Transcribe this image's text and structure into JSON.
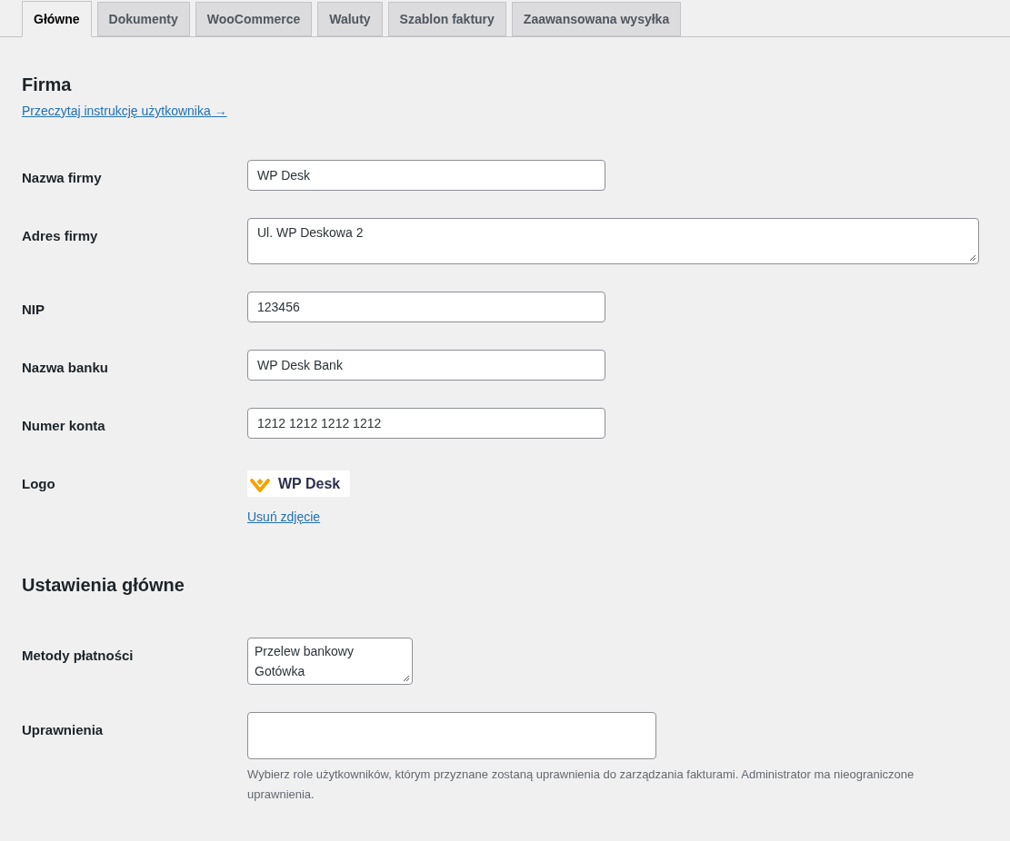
{
  "tabs": [
    {
      "label": "Główne",
      "selected": true
    },
    {
      "label": "Dokumenty",
      "selected": false
    },
    {
      "label": "WooCommerce",
      "selected": false
    },
    {
      "label": "Waluty",
      "selected": false
    },
    {
      "label": "Szablon faktury",
      "selected": false
    },
    {
      "label": "Zaawansowana wysyłka",
      "selected": false
    }
  ],
  "sections": [
    {
      "title": "Firma",
      "link": "Przeczytaj instrukcję użytkownika →",
      "fields": [
        {
          "kind": "text",
          "label": "Nazwa firmy",
          "value": "WP Desk"
        },
        {
          "kind": "textarea",
          "label": "Adres firmy",
          "value": "Ul. WP Deskowa 2"
        },
        {
          "kind": "text",
          "label": "NIP",
          "value": "123456"
        },
        {
          "kind": "text",
          "label": "Nazwa banku",
          "value": "WP Desk Bank"
        },
        {
          "kind": "text",
          "label": "Numer konta",
          "value": "1212 1212 1212 1212"
        },
        {
          "kind": "logo",
          "label": "Logo",
          "logo_text": "WP Desk",
          "action": "Usuń zdjęcie"
        }
      ]
    },
    {
      "title": "Ustawienia główne",
      "fields": [
        {
          "kind": "list",
          "label": "Metody płatności",
          "lines": [
            "Przelew bankowy",
            "Gotówka"
          ]
        },
        {
          "kind": "multiselect",
          "label": "Uprawnienia",
          "description": "Wybierz role użytkowników, którym przyznane zostaną uprawnienia do zarządzania fakturami. Administrator ma nieograniczone uprawnienia."
        }
      ]
    }
  ]
}
